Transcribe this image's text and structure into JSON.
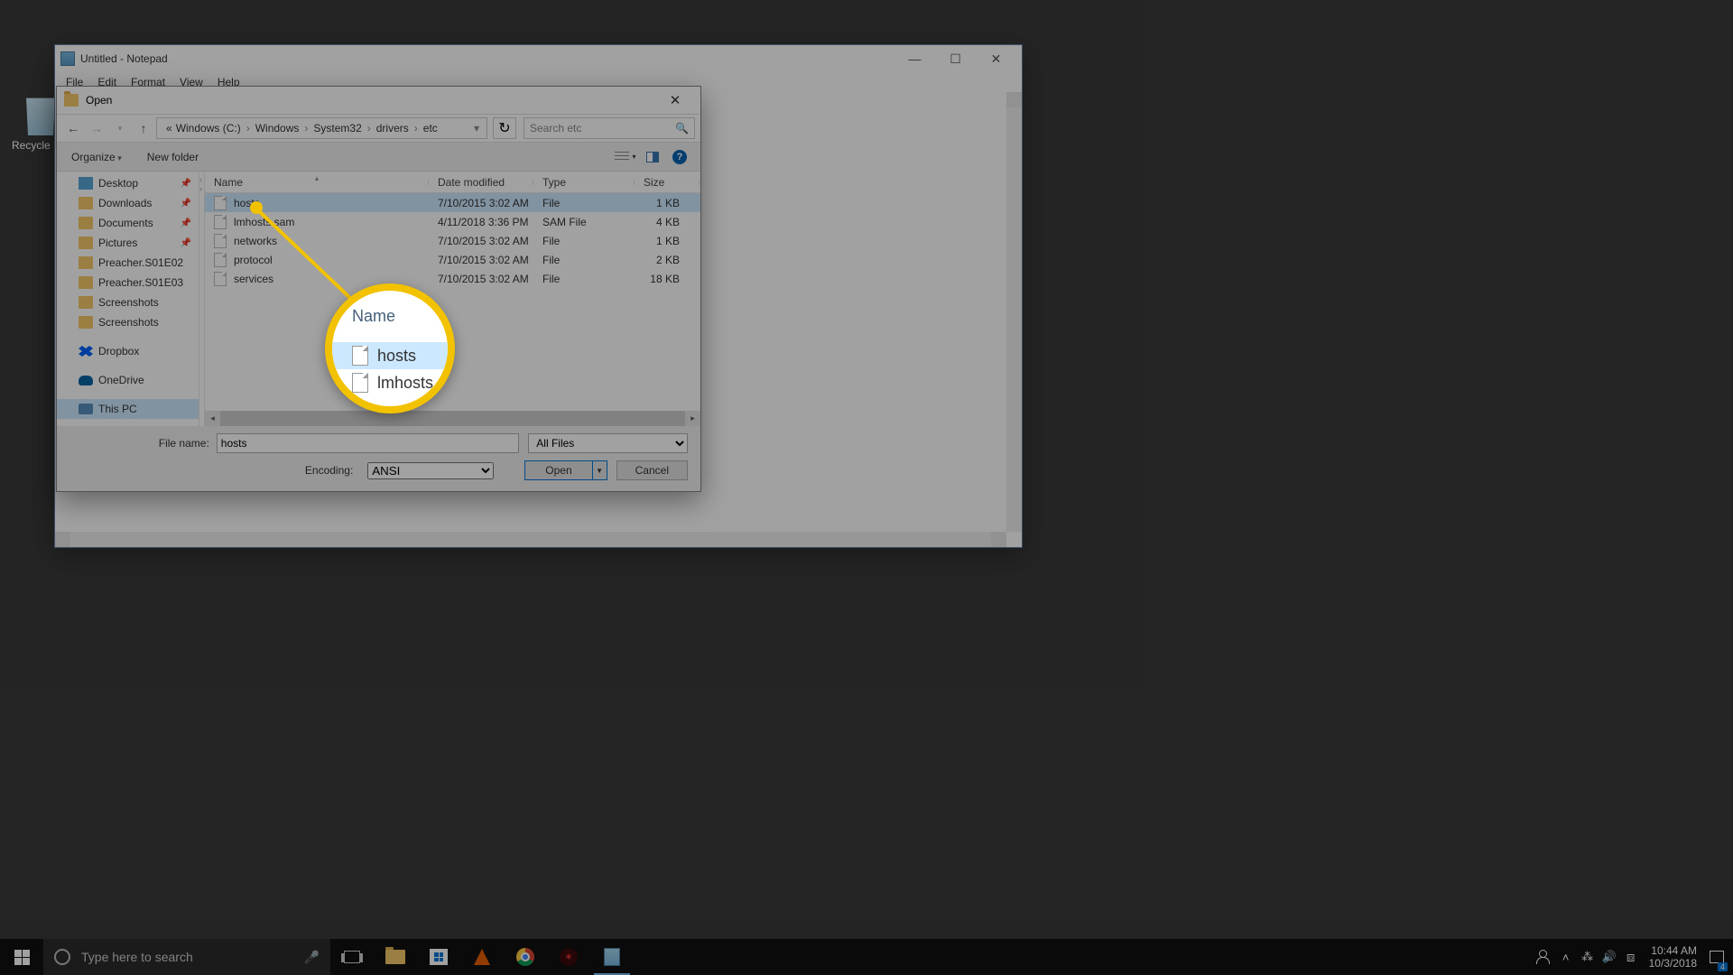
{
  "desktop": {
    "recycle_bin": "Recycle B..."
  },
  "notepad": {
    "title": "Untitled - Notepad",
    "menus": {
      "file": "File",
      "edit": "Edit",
      "format": "Format",
      "view": "View",
      "help": "Help"
    }
  },
  "dialog": {
    "title": "Open",
    "breadcrumb": {
      "prefix": "«",
      "items": [
        "Windows (C:)",
        "Windows",
        "System32",
        "drivers",
        "etc"
      ]
    },
    "search_placeholder": "Search etc",
    "toolbar": {
      "organize": "Organize",
      "new_folder": "New folder"
    },
    "sidebar": [
      {
        "label": "Desktop",
        "icon": "desk",
        "pinned": true
      },
      {
        "label": "Downloads",
        "icon": "folder",
        "pinned": true
      },
      {
        "label": "Documents",
        "icon": "folder",
        "pinned": true
      },
      {
        "label": "Pictures",
        "icon": "folder",
        "pinned": true
      },
      {
        "label": "Preacher.S01E02",
        "icon": "folder"
      },
      {
        "label": "Preacher.S01E03",
        "icon": "folder"
      },
      {
        "label": "Screenshots",
        "icon": "folder"
      },
      {
        "label": "Screenshots",
        "icon": "folder"
      },
      {
        "label": "Dropbox",
        "icon": "dropbox",
        "spaced": true
      },
      {
        "label": "OneDrive",
        "icon": "onedrive",
        "spaced": true
      },
      {
        "label": "This PC",
        "icon": "thispc",
        "spaced": true,
        "selected": true
      }
    ],
    "columns": {
      "name": "Name",
      "date": "Date modified",
      "type": "Type",
      "size": "Size"
    },
    "files": [
      {
        "name": "hosts",
        "date": "7/10/2015 3:02 AM",
        "type": "File",
        "size": "1 KB",
        "selected": true
      },
      {
        "name": "lmhosts.sam",
        "date": "4/11/2018 3:36 PM",
        "type": "SAM File",
        "size": "4 KB"
      },
      {
        "name": "networks",
        "date": "7/10/2015 3:02 AM",
        "type": "File",
        "size": "1 KB"
      },
      {
        "name": "protocol",
        "date": "7/10/2015 3:02 AM",
        "type": "File",
        "size": "2 KB"
      },
      {
        "name": "services",
        "date": "7/10/2015 3:02 AM",
        "type": "File",
        "size": "18 KB"
      }
    ],
    "file_name_label": "File name:",
    "file_name_value": "hosts",
    "filter_value": "All Files",
    "encoding_label": "Encoding:",
    "encoding_value": "ANSI",
    "open_btn": "Open",
    "cancel_btn": "Cancel"
  },
  "magnifier": {
    "header": "Name",
    "row1": "hosts",
    "row2": "lmhosts.s"
  },
  "taskbar": {
    "search_placeholder": "Type here to search",
    "clock_time": "10:44 AM",
    "clock_date": "10/3/2018",
    "notif_count": "4"
  }
}
